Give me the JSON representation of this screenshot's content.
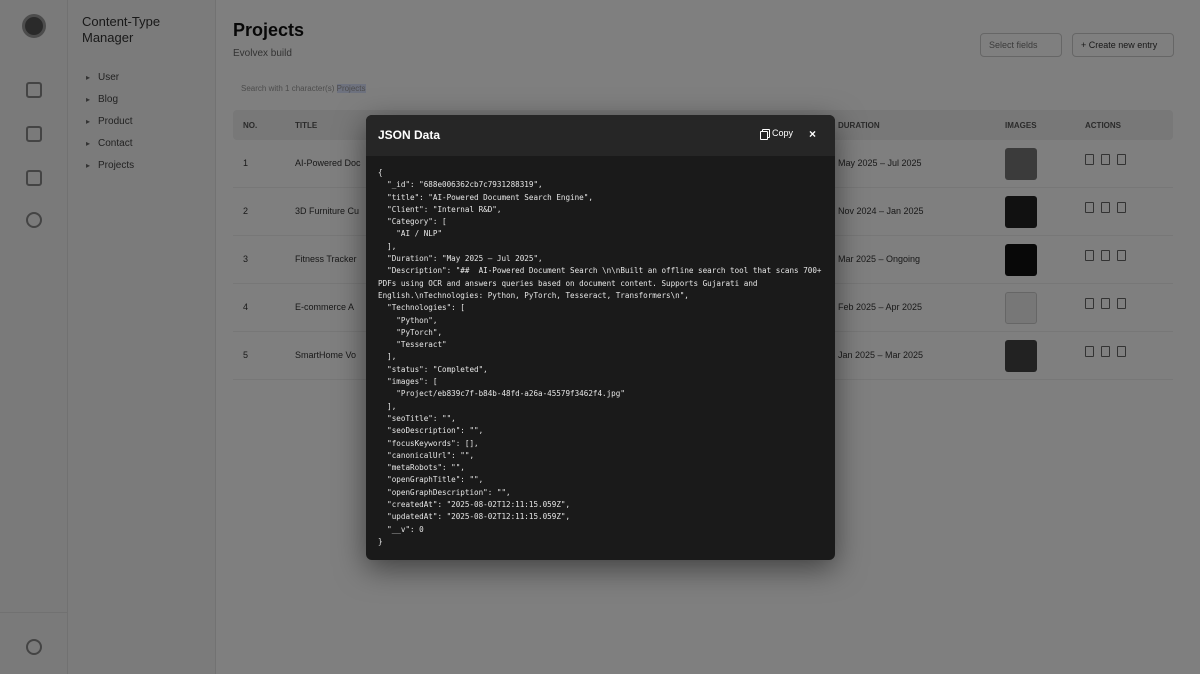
{
  "app": {
    "section_title": "Content-Type Manager",
    "content_types": [
      "User",
      "Blog",
      "Product",
      "Contact",
      "Projects"
    ]
  },
  "page": {
    "title": "Projects",
    "subtitle": "Evolvex build",
    "select_field_placeholder": "Select fields",
    "create_button_label": "+ Create new entry",
    "search_text": "Search with 1 character(s)",
    "search_highlight": "Projects"
  },
  "table": {
    "headers": [
      "NO.",
      "TITLE",
      "DURATION",
      "IMAGES",
      "ACTIONS"
    ],
    "rows": [
      {
        "no": "1",
        "title": "AI-Powered Doc",
        "duration": "May 2025 – Jul 2025"
      },
      {
        "no": "2",
        "title": "3D Furniture Cu",
        "duration": "Nov 2024 – Jan 2025"
      },
      {
        "no": "3",
        "title": "Fitness Tracker",
        "duration": "Mar 2025 – Ongoing"
      },
      {
        "no": "4",
        "title": "E-commerce A",
        "duration": "Feb 2025 – Apr 2025"
      },
      {
        "no": "5",
        "title": "SmartHome Vo",
        "duration": "Jan 2025 – Mar 2025"
      }
    ]
  },
  "modal": {
    "title": "JSON Data",
    "copy_label": "Copy",
    "close_label": "×",
    "json_text": "{\n  \"_id\": \"688e006362cb7c7931288319\",\n  \"title\": \"AI-Powered Document Search Engine\",\n  \"Client\": \"Internal R&D\",\n  \"Category\": [\n    \"AI / NLP\"\n  ],\n  \"Duration\": \"May 2025 – Jul 2025\",\n  \"Description\": \"##  AI-Powered Document Search \\n\\nBuilt an offline search tool that scans 700+ PDFs using OCR and answers queries based on document content. Supports Gujarati and English.\\nTechnologies: Python, PyTorch, Tesseract, Transformers\\n\",\n  \"Technologies\": [\n    \"Python\",\n    \"PyTorch\",\n    \"Tesseract\"\n  ],\n  \"status\": \"Completed\",\n  \"images\": [\n    \"Project/eb839c7f-b84b-48fd-a26a-45579f3462f4.jpg\"\n  ],\n  \"seoTitle\": \"\",\n  \"seoDescription\": \"\",\n  \"focusKeywords\": [],\n  \"canonicalUrl\": \"\",\n  \"metaRobots\": \"\",\n  \"openGraphTitle\": \"\",\n  \"openGraphDescription\": \"\",\n  \"createdAt\": \"2025-08-02T12:11:15.059Z\",\n  \"updatedAt\": \"2025-08-02T12:11:15.059Z\",\n  \"__v\": 0\n}"
  },
  "colors": {
    "modal_background": "#1a1a1a",
    "modal_header": "#262626",
    "overlay": "rgba(0,0,0,0.5)"
  }
}
